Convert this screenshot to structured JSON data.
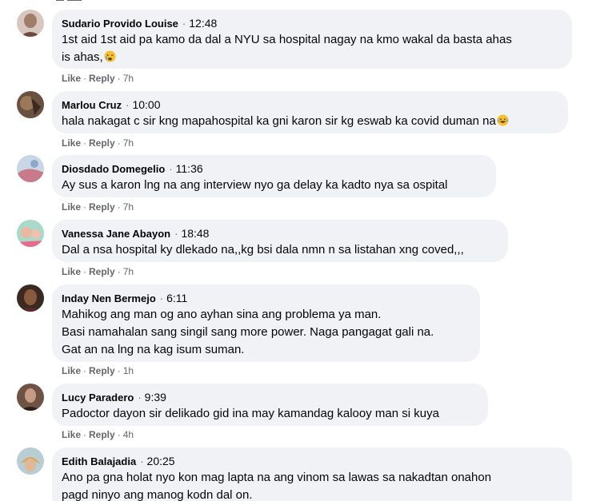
{
  "comments": [
    {
      "author": "Sudario Provido Louise",
      "time": "12:48",
      "lines": [
        "1st aid 1st aid pa kamo da dal a NYU sa hospital nagay na kmo wakal da basta ahas",
        "is ahas,"
      ],
      "emoji": "crying-face",
      "age": "7h"
    },
    {
      "author": "Marlou Cruz",
      "time": "10:00",
      "lines": [
        "hala nakagat c sir kng mapahospital ka gni karon sir kg eswab ka covid duman na"
      ],
      "emoji": "laughing-face",
      "age": "7h"
    },
    {
      "author": "Diosdado Domegelio",
      "time": "11:36",
      "lines": [
        "Ay sus a karon lng na ang interview nyo ga delay ka kadto nya sa ospital"
      ],
      "age": "7h"
    },
    {
      "author": "Vanessa Jane Abayon",
      "time": "18:48",
      "lines": [
        "Dal a nsa hospital ky dlekado na,,kg bsi dala nmn n sa listahan xng coved,,,"
      ],
      "age": "7h"
    },
    {
      "author": "Inday Nen Bermejo",
      "time": "6:11",
      "lines": [
        "Mahikog ang man og ano ayhan sina ang problema ya man.",
        "Basi namahalan sang singil sang more power. Naga pangagat gali na.",
        "Gat an na lng na kag isum suman."
      ],
      "age": "1h"
    },
    {
      "author": "Lucy Paradero",
      "time": "9:39",
      "lines": [
        "Padoctor dayon sir delikado gid ina may kamandag kalooy man si kuya"
      ],
      "age": "4h"
    },
    {
      "author": "Edith Balajadia",
      "time": "20:25",
      "lines": [
        "Ano pa gna holat nyo kon mag lapta na ang vinom sa lawas sa nakadtan onahon",
        "pagd ninyo ang manog kodn dal on."
      ],
      "age": ""
    }
  ],
  "actions": {
    "like": "Like",
    "reply": "Reply",
    "dot": "·"
  },
  "colors": {
    "bubble": "#f0f2f5",
    "text": "#050505",
    "secondary": "#65676b"
  }
}
